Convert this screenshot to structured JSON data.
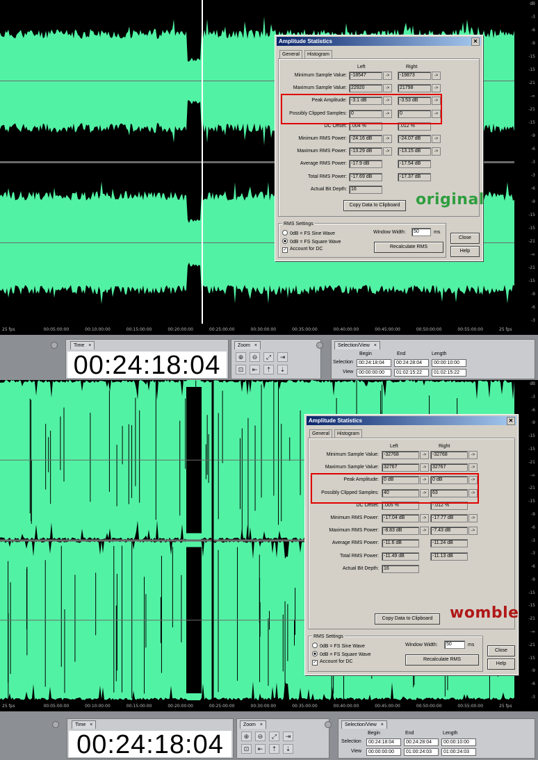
{
  "colors": {
    "waveform": "#52f2a4",
    "background": "#000000",
    "annotation_original": "#2e9e3e",
    "annotation_womble": "#b01818",
    "highlight": "#e00000"
  },
  "db_ruler": [
    "dB",
    "-3",
    "-6",
    "-9",
    "-15",
    "-15",
    "-21",
    "-∞",
    "-21",
    "-15",
    "-9",
    "-6",
    "-3",
    "-3",
    "-6",
    "-9",
    "-15",
    "-15",
    "-21",
    "-∞",
    "-21",
    "-15",
    "-9",
    "-6",
    "-3"
  ],
  "top": {
    "timeline": [
      "25 fps",
      "00:05:00:00",
      "00:10:00:00",
      "00:15:00:00",
      "00:20:00:00",
      "00:25:00:00",
      "00:30:00:00",
      "00:35:00:00",
      "00:40:00:00",
      "00:45:00:00",
      "00:50:00:00",
      "00:55:00:00",
      "25 fps"
    ],
    "time_display": {
      "tab": "Time",
      "value": "00:24:18:04"
    },
    "zoom": {
      "tab": "Zoom"
    },
    "selection_view": {
      "tab": "Selection/View",
      "headers": [
        "Begin",
        "End",
        "Length"
      ],
      "rows": [
        {
          "label": "Selection",
          "begin": "00:24:18:04",
          "end": "00:24:28:04",
          "length": "00:00:10:00"
        },
        {
          "label": "View",
          "begin": "00:00:00:00",
          "end": "01:02:15:22",
          "length": "01:02:15:22"
        }
      ]
    },
    "dialog": {
      "title": "Amplitude Statistics",
      "tabs": [
        "General",
        "Histogram"
      ],
      "col_left": "Left",
      "col_right": "Right",
      "rows": [
        {
          "label": "Minimum Sample Value:",
          "left": "-18547",
          "right": "-19873",
          "arrow": true
        },
        {
          "label": "Maximum Sample Value:",
          "left": "22920",
          "right": "21798",
          "arrow": true
        },
        {
          "label": "Peak Amplitude:",
          "left": "-3.1 dB",
          "right": "-3.53 dB",
          "arrow": true
        },
        {
          "label": "Possibly Clipped Samples:",
          "left": "0",
          "right": "0",
          "arrow": true
        },
        {
          "label": "DC Offset:",
          "left": ".004 %",
          "right": ".012 %",
          "arrow": false
        },
        {
          "label": "Minimum RMS Power:",
          "left": "-24.16 dB",
          "right": "-24.07 dB",
          "arrow": true
        },
        {
          "label": "Maximum RMS Power:",
          "left": "-13.29 dB",
          "right": "-13.15 dB",
          "arrow": true
        },
        {
          "label": "Average RMS Power:",
          "left": "-17.9 dB",
          "right": "-17.54 dB",
          "arrow": false
        },
        {
          "label": "Total RMS Power:",
          "left": "-17.69 dB",
          "right": "-17.37 dB",
          "arrow": false
        },
        {
          "label": "Actual Bit Depth:",
          "left": "16",
          "right": "",
          "arrow": false
        }
      ],
      "copy_button": "Copy Data to Clipboard",
      "rms_group": "RMS Settings",
      "radio1": "0dB = FS Sine Wave",
      "radio2": "0dB = FS Square Wave",
      "checkbox": "Account for DC",
      "window_width_label": "Window Width:",
      "window_width_value": "50",
      "window_width_unit": "ms",
      "recalc_button": "Recalculate RMS",
      "close_button": "Close",
      "help_button": "Help",
      "annotation": "original"
    }
  },
  "bottom": {
    "timeline": [
      "25 fps",
      "00:05:00:00",
      "00:10:00:00",
      "00:15:00:00",
      "00:20:00:00",
      "00:25:00:00",
      "00:30:00:00",
      "00:35:00:00",
      "00:40:00:00",
      "00:45:00:00",
      "00:50:00:00",
      "00:55:00:00",
      "25 fps"
    ],
    "time_display": {
      "tab": "Time",
      "value": "00:24:18:04"
    },
    "zoom": {
      "tab": "Zoom"
    },
    "selection_view": {
      "tab": "Selection/View",
      "headers": [
        "Begin",
        "End",
        "Length"
      ],
      "rows": [
        {
          "label": "Selection",
          "begin": "00:24:18:04",
          "end": "00:24:28:04",
          "length": "00:00:10:00"
        },
        {
          "label": "View",
          "begin": "00:00:00:00",
          "end": "01:00:24:03",
          "length": "01:00:24:03"
        }
      ]
    },
    "dialog": {
      "title": "Amplitude Statistics",
      "tabs": [
        "General",
        "Histogram"
      ],
      "col_left": "Left",
      "col_right": "Right",
      "rows": [
        {
          "label": "Minimum Sample Value:",
          "left": "-32768",
          "right": "-32768",
          "arrow": true
        },
        {
          "label": "Maximum Sample Value:",
          "left": "32767",
          "right": "32767",
          "arrow": true
        },
        {
          "label": "Peak Amplitude:",
          "left": "0 dB",
          "right": "0 dB",
          "arrow": true
        },
        {
          "label": "Possibly Clipped Samples:",
          "left": "40",
          "right": "63",
          "arrow": true
        },
        {
          "label": "DC Offset:",
          "left": ".005 %",
          "right": "-.012 %",
          "arrow": false
        },
        {
          "label": "Minimum RMS Power:",
          "left": "-17.04 dB",
          "right": "-17.77 dB",
          "arrow": true
        },
        {
          "label": "Maximum RMS Power:",
          "left": "-8.83 dB",
          "right": "-7.43 dB",
          "arrow": true
        },
        {
          "label": "Average RMS Power:",
          "left": "-11.6 dB",
          "right": "-11.24 dB",
          "arrow": false
        },
        {
          "label": "Total RMS Power:",
          "left": "-11.49 dB",
          "right": "-11.13 dB",
          "arrow": false
        },
        {
          "label": "Actual Bit Depth:",
          "left": "16",
          "right": "",
          "arrow": false
        }
      ],
      "copy_button": "Copy Data to Clipboard",
      "rms_group": "RMS Settings",
      "radio1": "0dB = FS Sine Wave",
      "radio2": "0dB = FS Square Wave",
      "checkbox": "Account for DC",
      "window_width_label": "Window Width:",
      "window_width_value": "50",
      "window_width_unit": "ms",
      "recalc_button": "Recalculate RMS",
      "close_button": "Close",
      "help_button": "Help",
      "annotation": "womble"
    }
  }
}
